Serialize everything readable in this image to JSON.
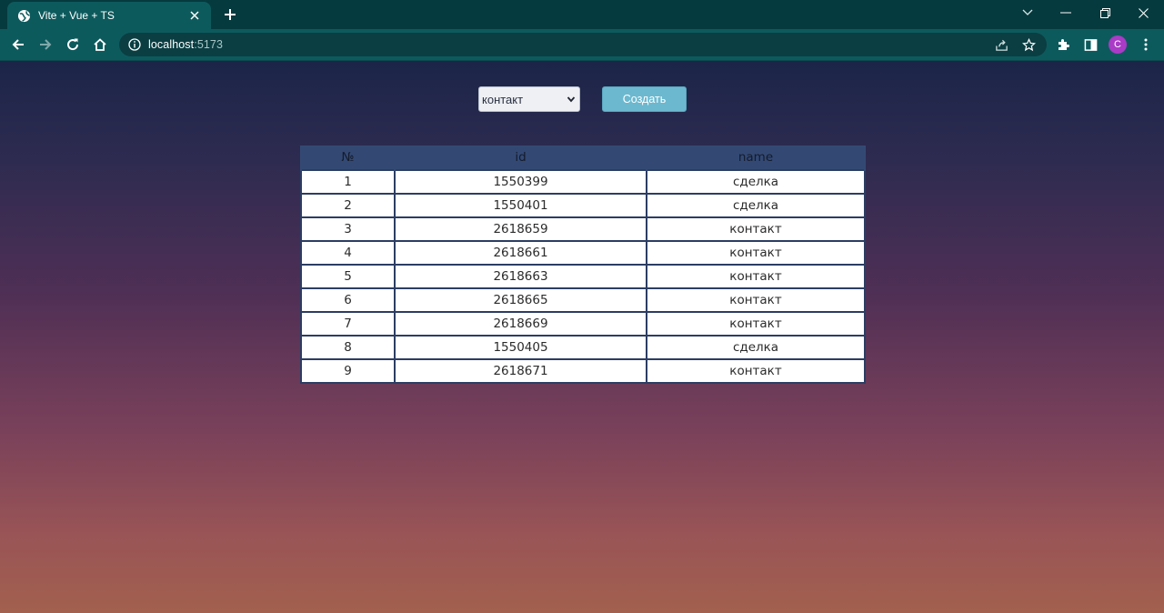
{
  "browser": {
    "tab": {
      "title": "Vite + Vue + TS"
    },
    "address": {
      "host": "localhost",
      "port": ":5173"
    },
    "profile_initial": "C",
    "colors": {
      "frame": "#053a3e",
      "toolbar": "#0d5a5d",
      "avatar": "#a93bc6"
    }
  },
  "controls": {
    "entity_select": {
      "selected": "контакт"
    },
    "create_button": {
      "label": "Создать"
    }
  },
  "table": {
    "columns": [
      "№",
      "id",
      "name"
    ],
    "rows": [
      {
        "n": "1",
        "id": "1550399",
        "name": "сделка"
      },
      {
        "n": "2",
        "id": "1550401",
        "name": "сделка"
      },
      {
        "n": "3",
        "id": "2618659",
        "name": "контакт"
      },
      {
        "n": "4",
        "id": "2618661",
        "name": "контакт"
      },
      {
        "n": "5",
        "id": "2618663",
        "name": "контакт"
      },
      {
        "n": "6",
        "id": "2618665",
        "name": "контакт"
      },
      {
        "n": "7",
        "id": "2618669",
        "name": "контакт"
      },
      {
        "n": "8",
        "id": "1550405",
        "name": "сделка"
      },
      {
        "n": "9",
        "id": "2618671",
        "name": "контакт"
      }
    ]
  },
  "icons": {
    "favicon": "globe-icon",
    "close": "close-icon",
    "new_tab": "plus-icon",
    "back": "back-arrow-icon",
    "forward": "forward-arrow-icon",
    "reload": "reload-icon",
    "home": "home-icon",
    "info": "info-icon",
    "share": "share-icon",
    "bookmark": "star-icon",
    "extensions": "puzzle-icon",
    "side_panel": "side-panel-icon",
    "menu": "kebab-menu-icon"
  }
}
